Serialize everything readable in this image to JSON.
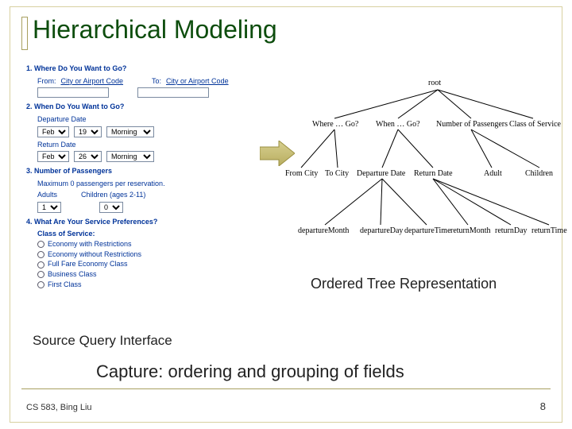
{
  "title": "Hierarchical Modeling",
  "form": {
    "q1": "1. Where Do You Want to Go?",
    "from_label": "From:",
    "from_hint": "City or Airport Code",
    "to_label": "To:",
    "to_hint": "City or Airport Code",
    "q2": "2. When Do You Want to Go?",
    "depart_label": "Departure Date",
    "return_label": "Return Date",
    "month1": "Feb",
    "day1": "19",
    "time1": "Morning",
    "month2": "Feb",
    "day2": "26",
    "time2": "Morning",
    "q3": "3. Number of Passengers",
    "pax_note": "Maximum 0 passengers per reservation.",
    "adults_label": "Adults",
    "children_label": "Children (ages 2-11)",
    "adults_val": "1",
    "children_val": "0",
    "q4": "4. What Are Your Service Preferences?",
    "cos_label": "Class of Service:",
    "cos1": "Economy with Restrictions",
    "cos2": "Economy without Restrictions",
    "cos3": "Full Fare Economy Class",
    "cos4": "Business Class",
    "cos5": "First Class"
  },
  "tree": {
    "root": "root",
    "where": "Where … Go?",
    "when": "When … Go?",
    "num": "Number of Passengers",
    "cos": "Class of Service",
    "from": "From City",
    "to": "To City",
    "dep": "Departure Date",
    "ret": "Return Date",
    "adult": "Adult",
    "child": "Children",
    "dMon": "departureMonth",
    "dDay": "departureDay",
    "dTime": "departureTime",
    "rMon": "returnMonth",
    "rDay": "returnDay",
    "rTime": "returnTime"
  },
  "captions": {
    "right": "Ordered Tree Representation",
    "left": "Source Query Interface",
    "capture": "Capture: ordering and grouping of fields"
  },
  "footer": {
    "left": "CS 583, Bing Liu",
    "right": "8"
  }
}
